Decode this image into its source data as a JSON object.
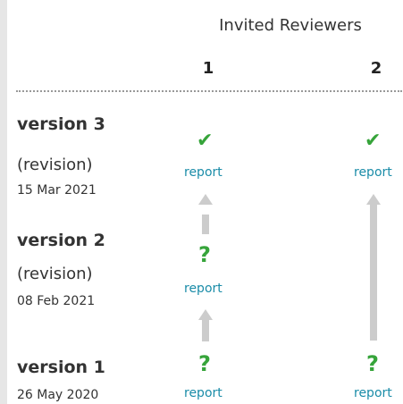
{
  "header": {
    "title": "Invited Reviewers",
    "columns": [
      "1",
      "2"
    ]
  },
  "versions": [
    {
      "label": "version 3",
      "note": "(revision)",
      "date": "15 Mar 2021",
      "reviews": [
        {
          "status": "approved",
          "icon": "check-icon",
          "symbol": "✔",
          "link": "report"
        },
        {
          "status": "approved",
          "icon": "check-icon",
          "symbol": "✔",
          "link": "report"
        }
      ]
    },
    {
      "label": "version 2",
      "note": "(revision)",
      "date": "08 Feb 2021",
      "reviews": [
        {
          "status": "approved-with-reservations",
          "icon": "question-icon",
          "symbol": "?",
          "link": "report"
        }
      ]
    },
    {
      "label": "version 1",
      "note": "",
      "date": "26 May 2020",
      "reviews": [
        {
          "status": "approved-with-reservations",
          "icon": "question-icon",
          "symbol": "?",
          "link": "report"
        },
        {
          "status": "approved-with-reservations",
          "icon": "question-icon",
          "symbol": "?",
          "link": "report"
        }
      ]
    }
  ],
  "colors": {
    "approved": "#36a43a",
    "link": "#1a8ca8",
    "arrow": "#cccccc",
    "rail": "#e6e6e6"
  }
}
